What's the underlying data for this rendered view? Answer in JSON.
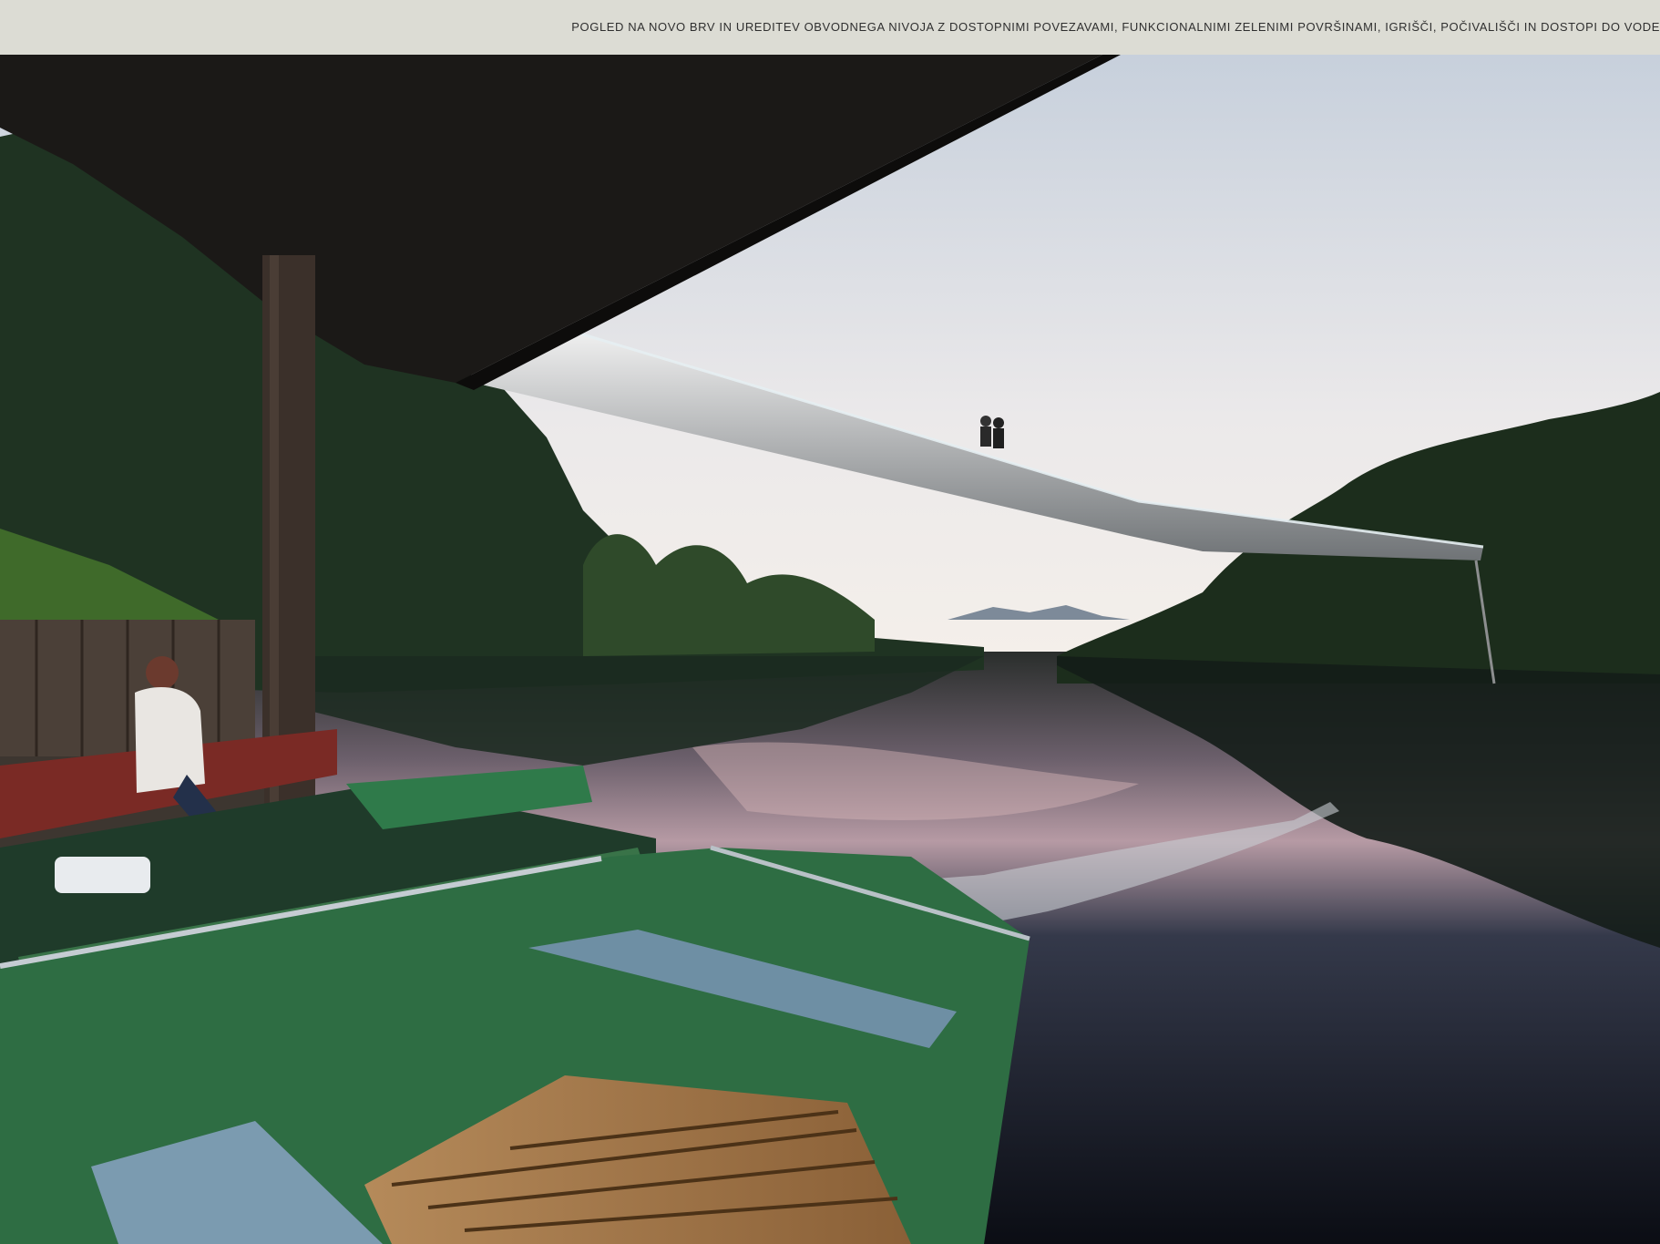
{
  "caption": "POGLED NA NOVO BRV IN UREDITEV OBVODNEGA NIVOJA Z DOSTOPNIMI POVEZAVAMI, FUNKCIONALNIMI ZELENIMI POVRŠINAMI, IGRIŠČI, POČIVALIŠČI IN DOSTOPI DO VODE",
  "colors": {
    "caption_bar": "#dcdcd4",
    "sky_top": "#c9d2de",
    "sky_bottom": "#f3eee9",
    "water_glow": "#d8b6b8",
    "boat_green": "#2f7a4a",
    "roof_dark": "#1b1917"
  }
}
